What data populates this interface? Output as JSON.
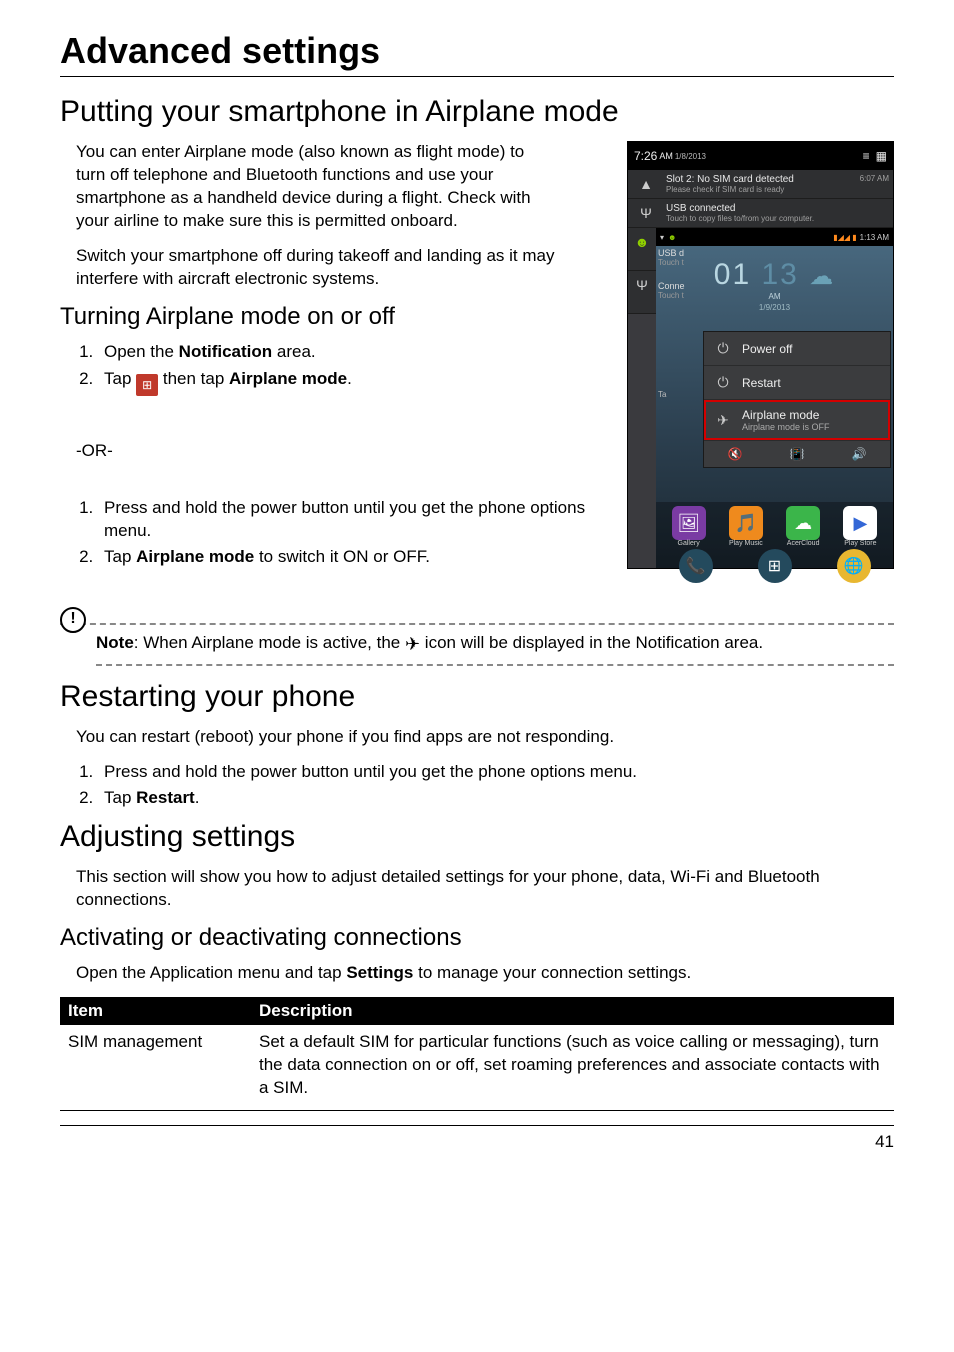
{
  "page": {
    "number": "41",
    "title": "Advanced settings"
  },
  "s1": {
    "heading": "Putting your smartphone in Airplane mode",
    "p1": "You can enter Airplane mode (also known as flight mode) to turn off telephone and Bluetooth functions and use your smartphone as a handheld device during a flight. Check with your airline to make sure this is permitted onboard.",
    "p2": "Switch your smartphone off during takeoff and landing as it may interfere with aircraft electronic systems.",
    "sub1": {
      "heading": "Turning Airplane mode on or off",
      "l1_pre": "Open the ",
      "l1_b": "Notification",
      "l1_post": " area.",
      "l2_pre": "Tap ",
      "l2_mid": " then tap ",
      "l2_b": "Airplane mode",
      "l2_post": "."
    },
    "or": "-OR-",
    "alt": {
      "l1": "Press and hold the power button until you get the phone options menu.",
      "l2_pre": "Tap ",
      "l2_b": "Airplane mode",
      "l2_post": " to switch it ON or OFF."
    },
    "note": {
      "label": "Note",
      "pre": ": When Airplane mode is active, the ",
      "post": " icon will be displayed in the Notification area."
    }
  },
  "s2": {
    "heading": "Restarting your phone",
    "p1": "You can restart (reboot) your phone if you find apps are not responding.",
    "l1": "Press and hold the power button until you get the phone options menu.",
    "l2_pre": "Tap ",
    "l2_b": "Restart",
    "l2_post": "."
  },
  "s3": {
    "heading": "Adjusting settings",
    "p1": "This section will show you how to adjust detailed settings for your phone, data, Wi-Fi and Bluetooth connections.",
    "sub1": {
      "heading": "Activating or deactivating connections",
      "p1_pre": "Open the Application menu and tap ",
      "p1_b": "Settings",
      "p1_post": " to manage your connection settings."
    },
    "table": {
      "h1": "Item",
      "h2": "Description",
      "r1c1": "SIM management",
      "r1c2": "Set a default SIM for particular functions (such as voice calling or messaging), turn the data connection on or off, set roaming preferences and associate contacts with a SIM."
    }
  },
  "shot": {
    "status_time": "7:26",
    "status_ampm": "AM",
    "status_date": "1/8/2013",
    "n1_title": "Slot 2: No SIM card detected",
    "n1_sub": "Please check if SIM card is ready",
    "n1_time": "6:07 AM",
    "n2_title": "USB connected",
    "n2_sub": "Touch to copy files to/from your computer.",
    "n3_title": "USB d",
    "n3_sub": "Touch t",
    "n4_title": "Conne",
    "n4_sub": "Touch t",
    "home_status_time": "1:13 AM",
    "clock_hh": "01",
    "clock_mm": "13",
    "clock_ampm": "AM",
    "clock_date": "1/9/2013",
    "pm1": "Power off",
    "pm2": "Restart",
    "pm3": "Airplane mode",
    "pm3s": "Airplane mode is OFF",
    "apps": {
      "a1": "Gallery",
      "a2": "Play Music",
      "a3": "AcerCloud",
      "a4": "Play Store"
    }
  }
}
